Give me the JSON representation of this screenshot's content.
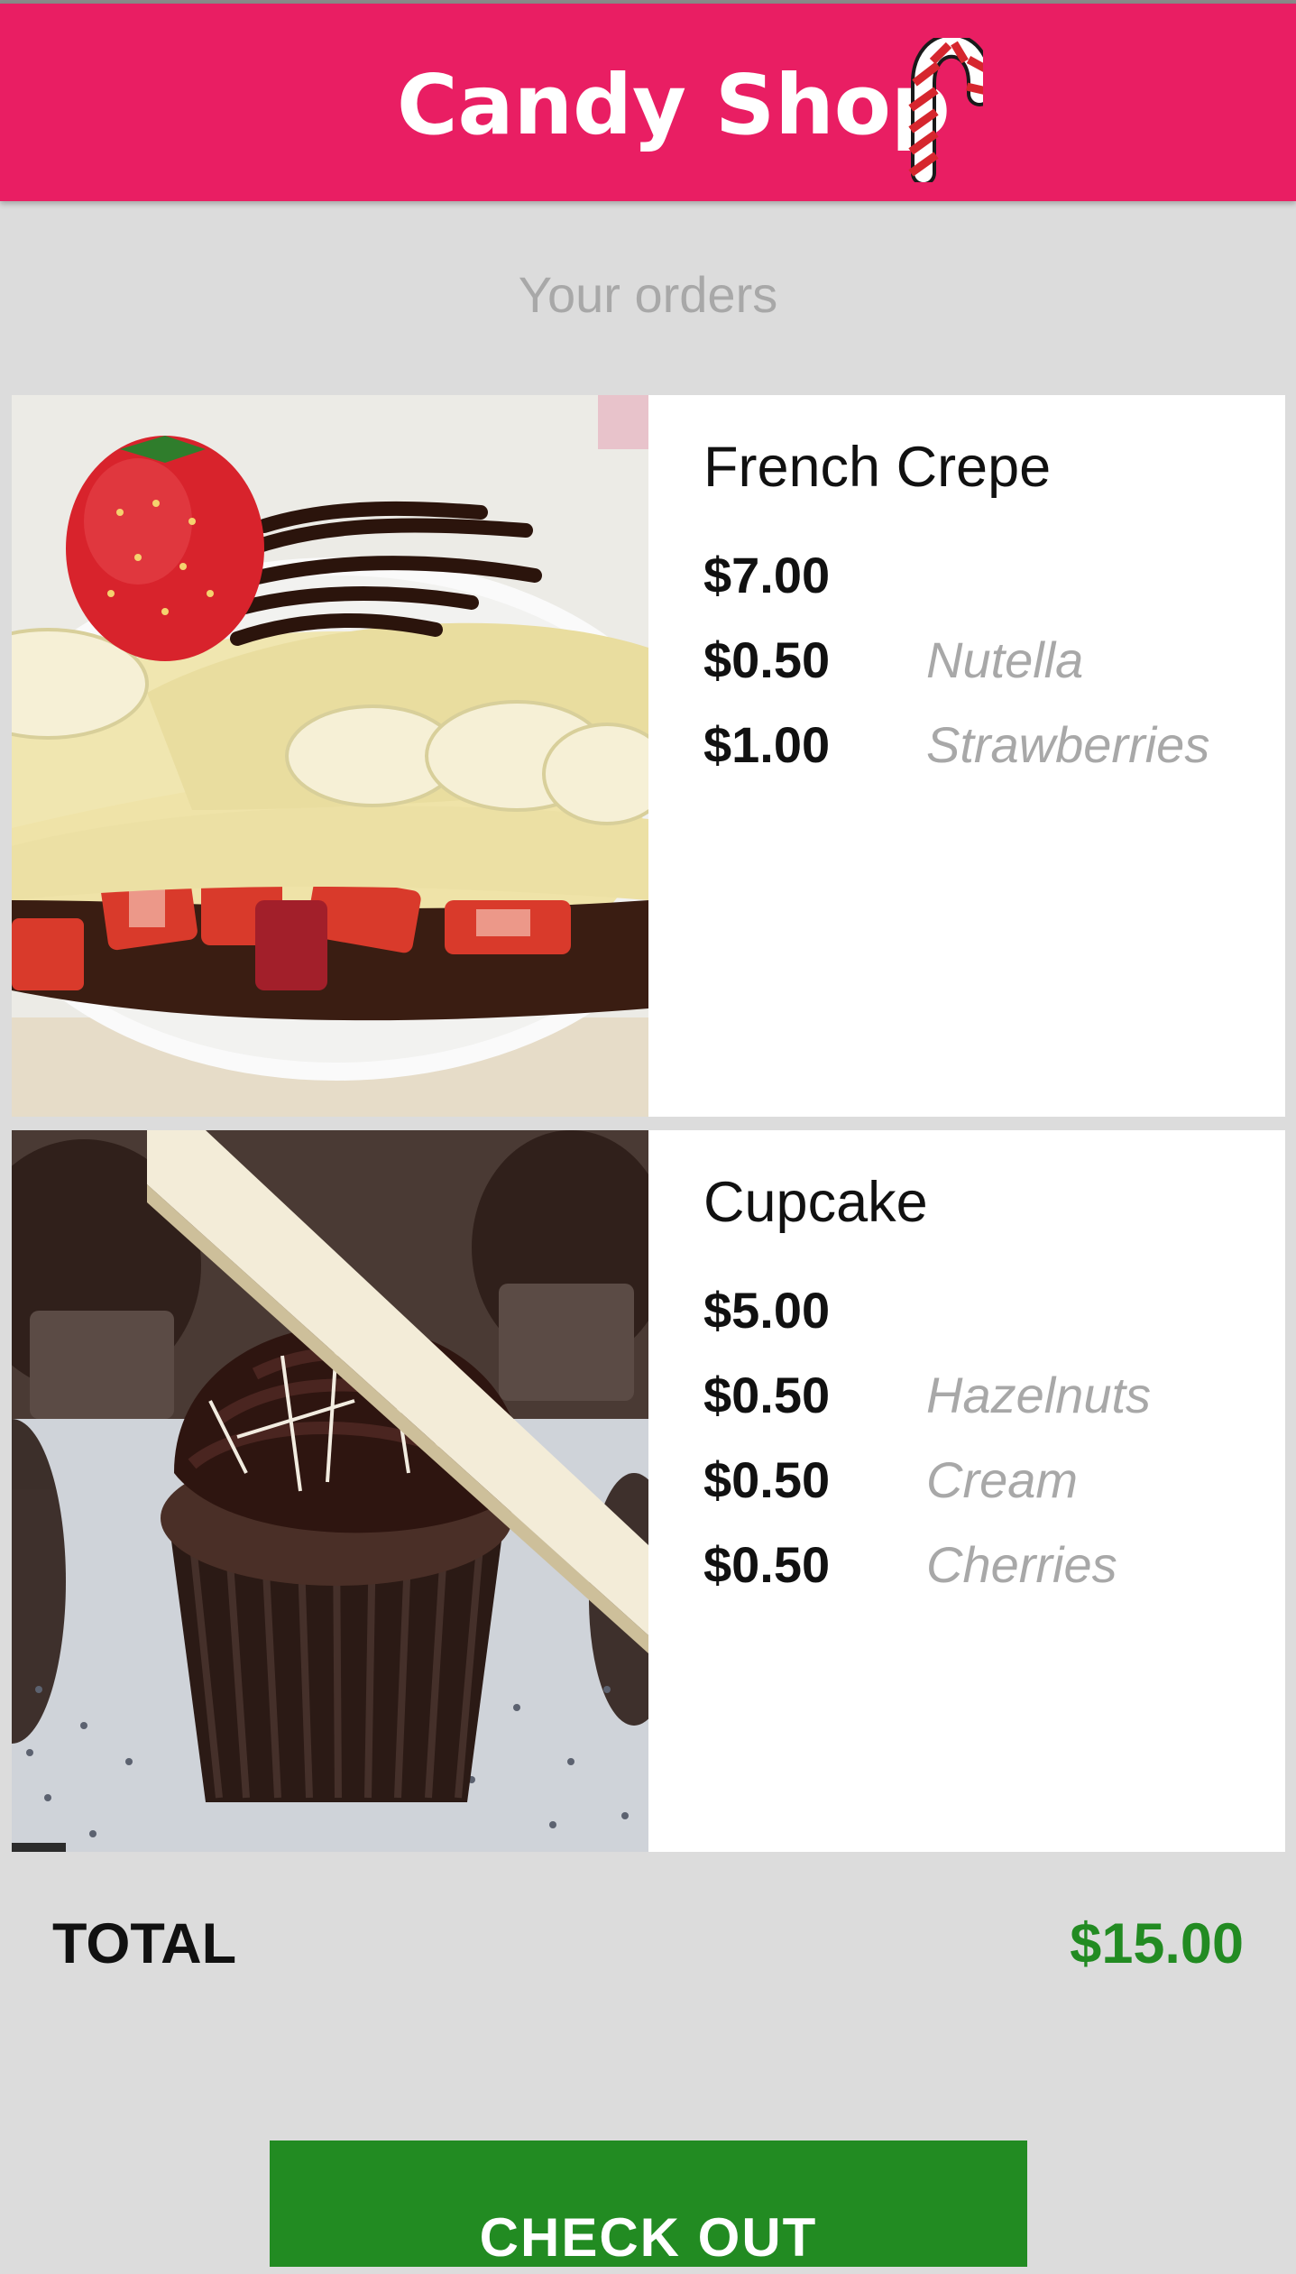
{
  "app": {
    "title": "Candy Shop",
    "icon": "candy-cane-icon"
  },
  "colors": {
    "header": "#e91e63",
    "background": "#dcdcdc",
    "total": "#228b22",
    "checkout": "#228b22",
    "muted": "#a8a8a8"
  },
  "subtitle": "Your orders",
  "orders": [
    {
      "name": "French Crepe",
      "image": "french-crepe-photo",
      "lines": [
        {
          "price": "$7.00",
          "label": ""
        },
        {
          "price": "$0.50",
          "label": "Nutella"
        },
        {
          "price": "$1.00",
          "label": "Strawberries"
        }
      ]
    },
    {
      "name": "Cupcake",
      "image": "chocolate-cupcake-photo",
      "lines": [
        {
          "price": "$5.00",
          "label": ""
        },
        {
          "price": "$0.50",
          "label": "Hazelnuts"
        },
        {
          "price": "$0.50",
          "label": "Cream"
        },
        {
          "price": "$0.50",
          "label": "Cherries"
        }
      ]
    }
  ],
  "total": {
    "label": "TOTAL",
    "value": "$15.00"
  },
  "checkout": {
    "label": "CHECK OUT"
  }
}
